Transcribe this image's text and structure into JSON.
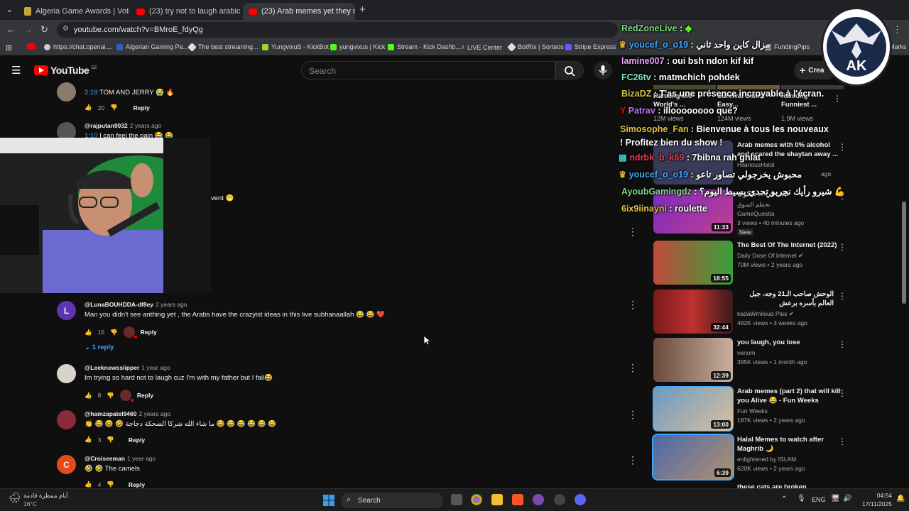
{
  "browser": {
    "tabs": [
      {
        "title": "Algeria Game Awards | Vote fo"
      },
      {
        "title": "(23) try not to laugh arabic me"
      },
      {
        "title": "(23) Arab memes yet they neve"
      }
    ],
    "url": "youtube.com/watch?v=BMroE_fdyQg",
    "bookmarks": [
      "https://chat.openai....",
      "Algerian Gaming Pe...",
      "The best streaming...",
      "YungvixuS - KickBot",
      "yungvixus | Kick",
      "Stream - Kick Dashb...",
      "LIVE Center",
      "BotRix | Sorteos",
      "Stripe Express",
      "FundingPips",
      "Marks"
    ]
  },
  "youtube": {
    "logo": "YouTube",
    "country": "DZ",
    "search_placeholder": "Search",
    "create_label": "Crea"
  },
  "comments": [
    {
      "handle": "",
      "time_ago": "",
      "timestamp": "2:19",
      "text": "TOM AND JERRY 😭 🔥",
      "likes": "20",
      "reply": "Reply",
      "color": "#8a7a6a"
    },
    {
      "handle": "@rajputan9032",
      "time_ago": "2 years ago",
      "timestamp": "1:10",
      "text": "I can feel the pain 😂 😂",
      "likes": "",
      "reply": "",
      "color": "#555"
    },
    {
      "handle": "",
      "time_ago": "",
      "timestamp": "",
      "text": "vent 😁",
      "likes": "",
      "reply": "",
      "color": ""
    },
    {
      "handle": "@LunaBOUHDDA-df8ey",
      "time_ago": "2 years ago",
      "timestamp": "",
      "text": "Man you didn't see anthing yet , the Arabs have the crazyist ideas in this live subhanaallah 😂 😂 ❤️",
      "likes": "15",
      "reply": "Reply",
      "replies": "1 reply",
      "avatar_letter": "L",
      "color": "#5e35b1"
    },
    {
      "handle": "@Leeknowsslipper",
      "time_ago": "1 year ago",
      "timestamp": "",
      "text": "Im trying so hard not to laugh cuz I'm with my father but I fail😂",
      "likes": "8",
      "reply": "Reply",
      "color": "#d8d4cc"
    },
    {
      "handle": "@hamzapatel9460",
      "time_ago": "2 years ago",
      "timestamp": "",
      "text": "👏 😂 😆 🤣 ما شاء الله شرکا الضحكة دجاجة 😂 😂 😂 😂 😂 😂",
      "likes": "3",
      "reply": "Reply",
      "color": "#8a2a3a"
    },
    {
      "handle": "@Croiseeman",
      "time_ago": "1 year ago",
      "timestamp": "",
      "text": "🤣 🤣 The camels",
      "likes": "4",
      "reply": "Reply",
      "avatar_letter": "C",
      "color": "#e64a19"
    }
  ],
  "sidebar_top": [
    {
      "title": "Ranking the World's ...",
      "views": "12M views"
    },
    {
      "title": "Survival Skills: Easy...",
      "views": "124M views"
    },
    {
      "title": "Ranking Funniest ...",
      "views": "1.9M views"
    }
  ],
  "videos": [
    {
      "title": "Arab memes with 0% alcohol and scared the shaytan away ...",
      "channel": "HilariousHalal",
      "meta": "ago",
      "duration": "",
      "thumb": "#3a3a5a"
    },
    {
      "title": "عقدة لي ... شكوب",
      "channel": "تحطم السوق",
      "channel2": "GameQuestia",
      "meta": "3 views • 40 minutes ago",
      "badge": "New",
      "duration": "11:33",
      "thumb": "#6a2ab0"
    },
    {
      "title": "The Best Of The Internet (2022)",
      "channel": "Daily Dose Of Internet",
      "meta": "70M views • 2 years ago",
      "duration": "18:55",
      "thumb": "#c05a3a"
    },
    {
      "title": "الوحش صاحب الـ21 وجه، جبل العالم بأسره برعش",
      "channel": "kadaWmiloud Plus",
      "meta": "482K views • 3 weeks ago",
      "duration": "32:44",
      "thumb": "#8a2020"
    },
    {
      "title": "you laugh, you lose",
      "channel": "venom",
      "meta": "395K views • 1 month ago",
      "duration": "12:39",
      "thumb": "#6a4a3a"
    },
    {
      "title": "Arab memes (part 2) that will kill you Alive 😂 - Fun Weeks",
      "channel": "Fun Weeks",
      "meta": "187K views • 2 years ago",
      "duration": "13:00",
      "thumb": "#5a8aaa"
    },
    {
      "title": "Halal Memes to watch after Maghrib 🌙",
      "channel": "enlightened by ISLAM",
      "meta": "620K views • 2 years ago",
      "duration": "6:39",
      "thumb": "#4a6a9a"
    },
    {
      "title": "these cats are broken",
      "channel": "",
      "meta": "",
      "duration": "",
      "thumb": "#333"
    }
  ],
  "chat": [
    {
      "user": "RedZoneLive",
      "msg": "",
      "color": "#7fd37f"
    },
    {
      "user": "youcef_o_o19",
      "msg": "مزال كاين واحد ثاني",
      "color": "#3ea6ff"
    },
    {
      "user": "lamine007",
      "msg": "oui bsh ndon kif kif",
      "color": "#f0a0ff"
    },
    {
      "user": "FC26tv",
      "msg": "matmchich pohdek",
      "color": "#7fe0d0"
    },
    {
      "user": "BizaDZ",
      "msg": "T'as une présence incroyable à l'écran.",
      "color": "#d8c040"
    },
    {
      "user": "Patrav",
      "msg": "illoooooooo que?",
      "color": "#c070ff"
    },
    {
      "user": "Simosophe_Fan",
      "msg": "Bienvenue à tous les nouveaux ! Profitez bien du show !",
      "color": "#e0c040"
    },
    {
      "user": "ndrbk_b_k69",
      "msg": "7bibna rah ghlat",
      "color": "#e04050"
    },
    {
      "user": "youcef_o_o19",
      "msg": "محبوش يخرجولي تصاور تاعو",
      "color": "#3ea6ff"
    },
    {
      "user": "AyoubGamingdz",
      "msg": "شيرو رأيك نجربو تحدي بسيط اليوم؟ 💪",
      "color": "#7fd37f"
    },
    {
      "user": "6ix9iinayni",
      "msg": "roulette",
      "color": "#e0c040"
    }
  ],
  "taskbar": {
    "weather_text": "أيام ممطرة قادمة",
    "temperature": "16°C",
    "search": "Search",
    "lang": "ENG",
    "time": "04:54",
    "date": "17/11/2025"
  },
  "streamer_logo_text": "AK STREAMS"
}
